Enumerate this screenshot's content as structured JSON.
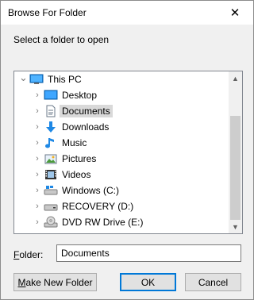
{
  "dialog": {
    "title": "Browse For Folder",
    "close_glyph": "✕",
    "prompt": "Select a folder to open"
  },
  "tree": {
    "items": [
      {
        "label": "This PC",
        "icon": "pc-icon",
        "expanded": true,
        "level": 0
      },
      {
        "label": "Desktop",
        "icon": "desktop-icon",
        "level": 1
      },
      {
        "label": "Documents",
        "icon": "documents-icon",
        "level": 1,
        "selected": true
      },
      {
        "label": "Downloads",
        "icon": "downloads-icon",
        "level": 1
      },
      {
        "label": "Music",
        "icon": "music-icon",
        "level": 1
      },
      {
        "label": "Pictures",
        "icon": "pictures-icon",
        "level": 1
      },
      {
        "label": "Videos",
        "icon": "videos-icon",
        "level": 1
      },
      {
        "label": "Windows (C:)",
        "icon": "windows-drive-icon",
        "level": 1
      },
      {
        "label": "RECOVERY (D:)",
        "icon": "drive-icon",
        "level": 1
      },
      {
        "label": "DVD RW Drive (E:)",
        "icon": "dvd-drive-icon",
        "level": 1
      }
    ]
  },
  "folder": {
    "label_prefix": "F",
    "label_rest": "older:",
    "value": "Documents"
  },
  "buttons": {
    "new_folder_prefix": "M",
    "new_folder_rest": "ake New Folder",
    "ok": "OK",
    "cancel": "Cancel"
  },
  "colors": {
    "accent": "#0078d7",
    "selection": "#d9d9d9"
  }
}
